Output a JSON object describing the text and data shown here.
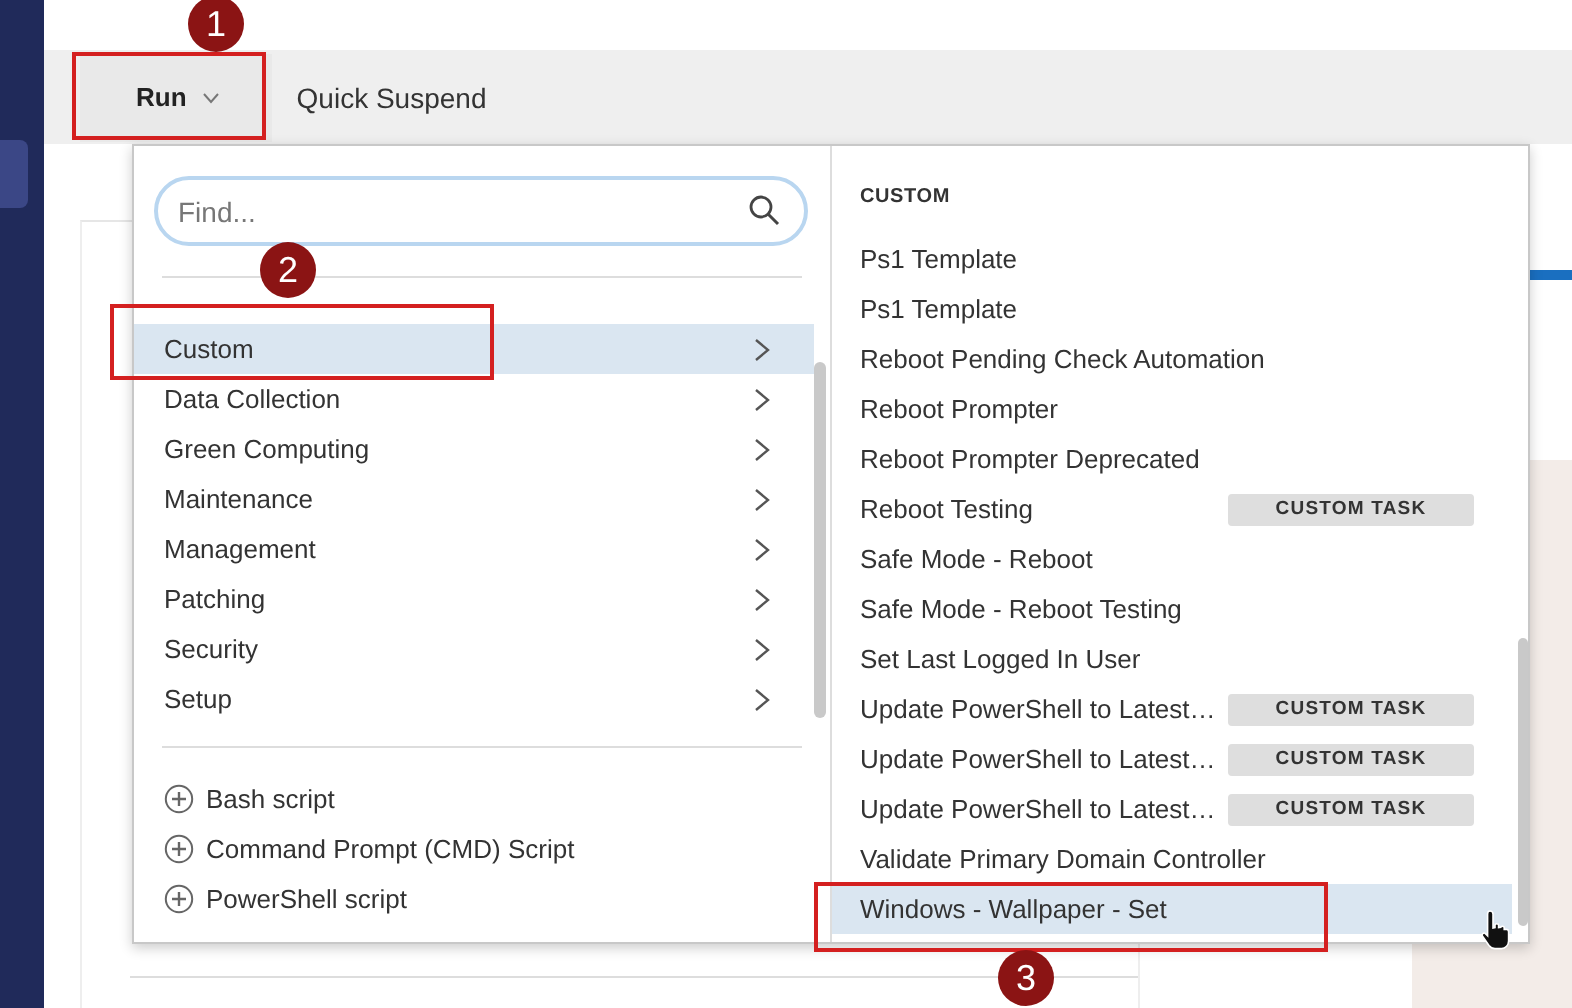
{
  "toolbar": {
    "run_button": {
      "label": "Run",
      "expanded": true
    },
    "quick_suspend": "Quick Suspend"
  },
  "run_menu": {
    "search": {
      "placeholder": "Find..."
    },
    "categories": [
      {
        "label": "Custom",
        "selected": true
      },
      {
        "label": "Data Collection",
        "selected": false
      },
      {
        "label": "Green Computing",
        "selected": false
      },
      {
        "label": "Maintenance",
        "selected": false
      },
      {
        "label": "Management",
        "selected": false
      },
      {
        "label": "Patching",
        "selected": false
      },
      {
        "label": "Security",
        "selected": false
      },
      {
        "label": "Setup",
        "selected": false
      }
    ],
    "script_actions": [
      "Bash script",
      "Command Prompt (CMD) Script",
      "PowerShell script"
    ],
    "section_title": "CUSTOM",
    "tasks": [
      {
        "label": "Ps1 Template",
        "selected": false
      },
      {
        "label": "Ps1 Template",
        "selected": false
      },
      {
        "label": "Reboot Pending Check Automation",
        "selected": false
      },
      {
        "label": "Reboot Prompter",
        "selected": false
      },
      {
        "label": "Reboot Prompter Deprecated",
        "selected": false
      },
      {
        "label": "Reboot Testing",
        "badge": "CUSTOM TASK",
        "selected": false
      },
      {
        "label": "Safe Mode - Reboot",
        "selected": false
      },
      {
        "label": "Safe Mode - Reboot Testing",
        "selected": false
      },
      {
        "label": "Set Last Logged In User",
        "selected": false
      },
      {
        "label": "Update PowerShell to Latest…",
        "badge": "CUSTOM TASK",
        "selected": false
      },
      {
        "label": "Update PowerShell to Latest…",
        "badge": "CUSTOM TASK",
        "selected": false
      },
      {
        "label": "Update PowerShell to Latest…",
        "badge": "CUSTOM TASK",
        "selected": false
      },
      {
        "label": "Validate Primary Domain Controller",
        "selected": false
      },
      {
        "label": "Windows - Wallpaper - Set",
        "selected": true
      }
    ]
  },
  "annotations": [
    {
      "number": "1"
    },
    {
      "number": "2"
    },
    {
      "number": "3"
    }
  ]
}
